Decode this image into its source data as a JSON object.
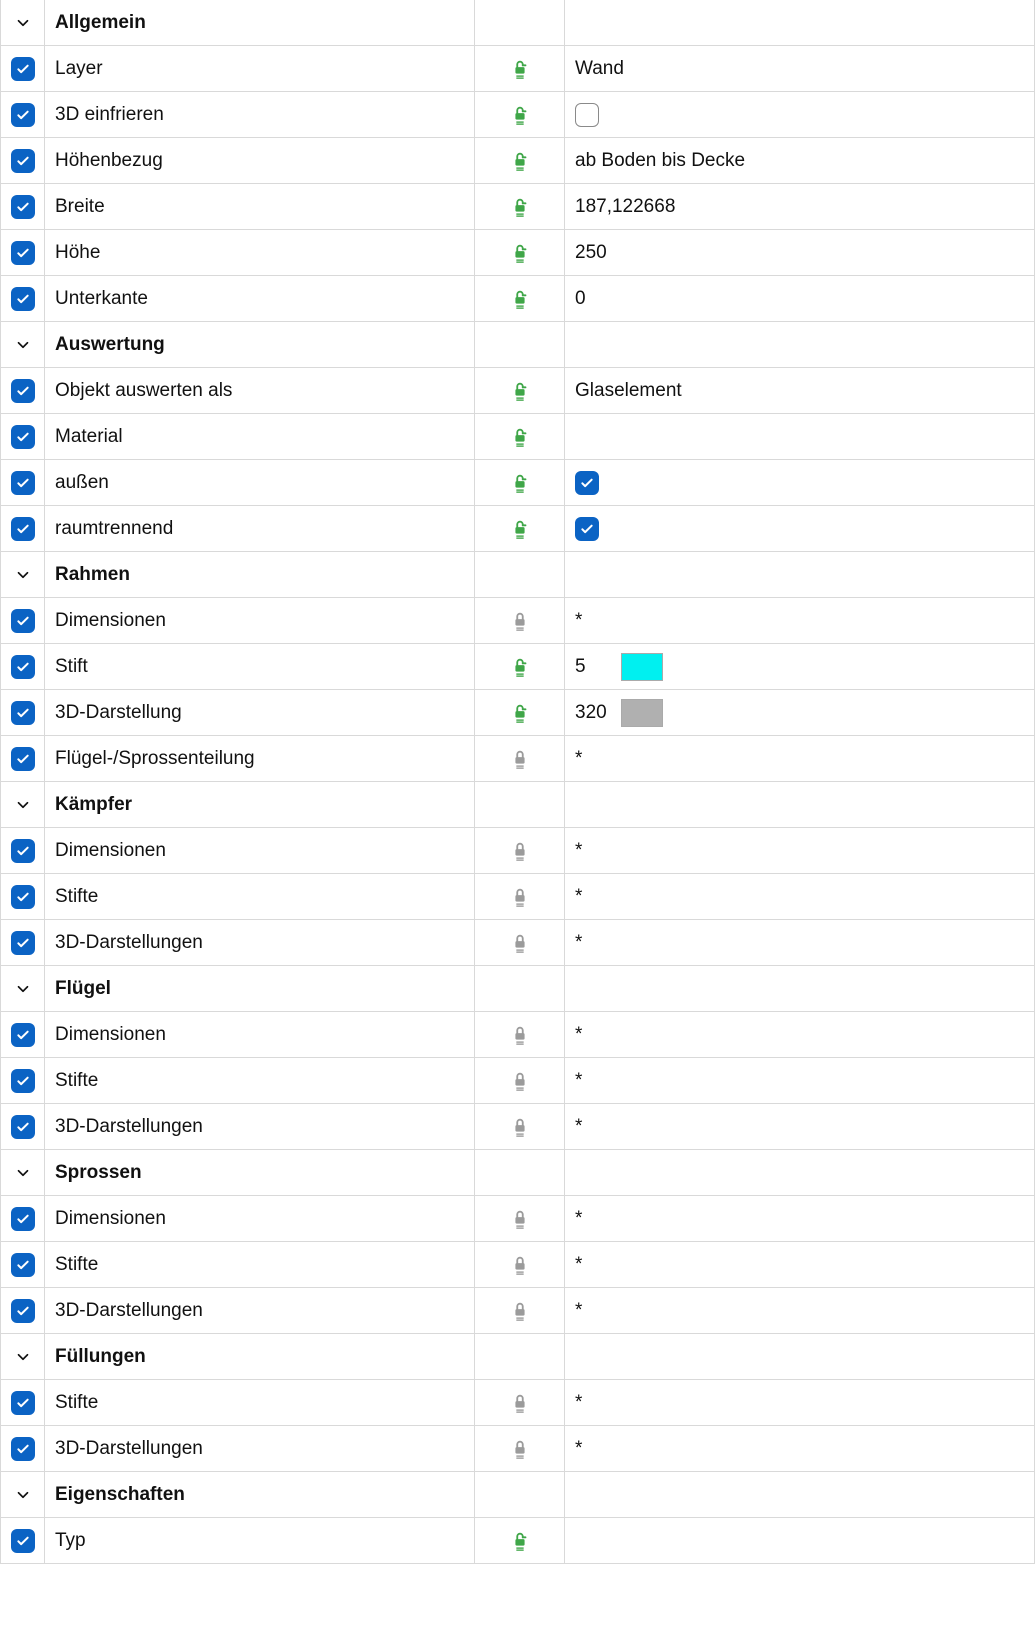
{
  "rows": [
    {
      "kind": "header",
      "label": "Allgemein"
    },
    {
      "kind": "prop",
      "label": "Layer",
      "lock": "unlocked",
      "value": {
        "type": "text",
        "text": "Wand"
      }
    },
    {
      "kind": "prop",
      "label": "3D einfrieren",
      "lock": "unlocked",
      "value": {
        "type": "unchecked"
      }
    },
    {
      "kind": "prop",
      "label": "Höhenbezug",
      "lock": "unlocked",
      "value": {
        "type": "text",
        "text": "ab Boden bis Decke"
      }
    },
    {
      "kind": "prop",
      "label": "Breite",
      "lock": "unlocked",
      "value": {
        "type": "text",
        "text": "187,122668"
      }
    },
    {
      "kind": "prop",
      "label": "Höhe",
      "lock": "unlocked",
      "value": {
        "type": "text",
        "text": "250"
      }
    },
    {
      "kind": "prop",
      "label": "Unterkante",
      "lock": "unlocked",
      "value": {
        "type": "text",
        "text": "0"
      }
    },
    {
      "kind": "header",
      "label": "Auswertung"
    },
    {
      "kind": "prop",
      "label": "Objekt auswerten als",
      "lock": "unlocked",
      "value": {
        "type": "text",
        "text": "Glaselement"
      }
    },
    {
      "kind": "prop",
      "label": "Material",
      "lock": "unlocked",
      "value": {
        "type": "text",
        "text": ""
      }
    },
    {
      "kind": "prop",
      "label": "außen",
      "lock": "unlocked",
      "value": {
        "type": "checked"
      }
    },
    {
      "kind": "prop",
      "label": "raumtrennend",
      "lock": "unlocked",
      "value": {
        "type": "checked"
      }
    },
    {
      "kind": "header",
      "label": "Rahmen"
    },
    {
      "kind": "prop",
      "label": "Dimensionen",
      "lock": "locked",
      "value": {
        "type": "text",
        "text": "*"
      }
    },
    {
      "kind": "prop",
      "label": "Stift",
      "lock": "unlocked",
      "value": {
        "type": "pen",
        "text": "5",
        "color": "#00F0F0"
      }
    },
    {
      "kind": "prop",
      "label": "3D-Darstellung",
      "lock": "unlocked",
      "value": {
        "type": "pen",
        "text": "320",
        "color": "#B0B0B0"
      }
    },
    {
      "kind": "prop",
      "label": "Flügel-/Sprossenteilung",
      "lock": "locked",
      "value": {
        "type": "text",
        "text": "*"
      }
    },
    {
      "kind": "header",
      "label": "Kämpfer"
    },
    {
      "kind": "prop",
      "label": "Dimensionen",
      "lock": "locked",
      "value": {
        "type": "text",
        "text": "*"
      }
    },
    {
      "kind": "prop",
      "label": "Stifte",
      "lock": "locked",
      "value": {
        "type": "text",
        "text": "*"
      }
    },
    {
      "kind": "prop",
      "label": "3D-Darstellungen",
      "lock": "locked",
      "value": {
        "type": "text",
        "text": "*"
      }
    },
    {
      "kind": "header",
      "label": "Flügel"
    },
    {
      "kind": "prop",
      "label": "Dimensionen",
      "lock": "locked",
      "value": {
        "type": "text",
        "text": "*"
      }
    },
    {
      "kind": "prop",
      "label": "Stifte",
      "lock": "locked",
      "value": {
        "type": "text",
        "text": "*"
      }
    },
    {
      "kind": "prop",
      "label": "3D-Darstellungen",
      "lock": "locked",
      "value": {
        "type": "text",
        "text": "*"
      }
    },
    {
      "kind": "header",
      "label": "Sprossen"
    },
    {
      "kind": "prop",
      "label": "Dimensionen",
      "lock": "locked",
      "value": {
        "type": "text",
        "text": "*"
      }
    },
    {
      "kind": "prop",
      "label": "Stifte",
      "lock": "locked",
      "value": {
        "type": "text",
        "text": "*"
      }
    },
    {
      "kind": "prop",
      "label": "3D-Darstellungen",
      "lock": "locked",
      "value": {
        "type": "text",
        "text": "*"
      }
    },
    {
      "kind": "header",
      "label": "Füllungen"
    },
    {
      "kind": "prop",
      "label": "Stifte",
      "lock": "locked",
      "value": {
        "type": "text",
        "text": "*"
      }
    },
    {
      "kind": "prop",
      "label": "3D-Darstellungen",
      "lock": "locked",
      "value": {
        "type": "text",
        "text": "*"
      }
    },
    {
      "kind": "header",
      "label": "Eigenschaften"
    },
    {
      "kind": "prop",
      "label": "Typ",
      "lock": "unlocked",
      "value": {
        "type": "text",
        "text": ""
      }
    }
  ],
  "icons": {
    "unlocked_color": "#3fa648",
    "locked_color": "#9b9b9b"
  }
}
